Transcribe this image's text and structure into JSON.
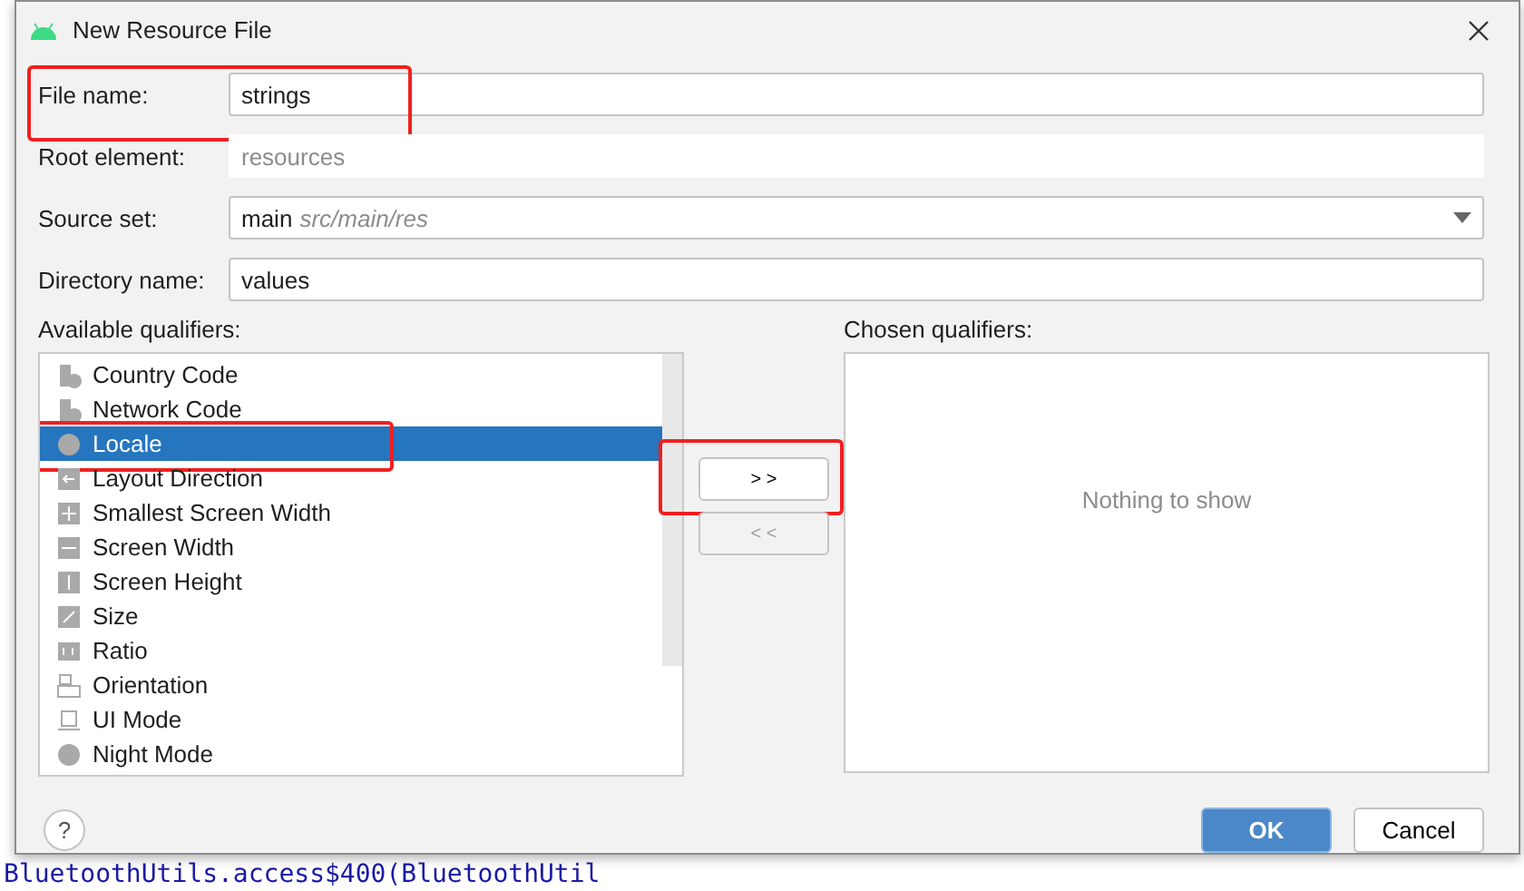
{
  "window": {
    "title": "New Resource File"
  },
  "fields": [
    {
      "kind": "text",
      "label": "File name:",
      "value": "strings",
      "disabled": false,
      "highlighted": true
    },
    {
      "kind": "text",
      "label": "Root element:",
      "placeholder": "resources",
      "disabled": true,
      "highlighted": false
    },
    {
      "kind": "select",
      "label": "Source set:",
      "value": "main",
      "detail": "src/main/res",
      "disabled": false,
      "highlighted": false
    },
    {
      "kind": "text",
      "label": "Directory name:",
      "value": "values",
      "disabled": false,
      "highlighted": false
    }
  ],
  "available": {
    "label": "Available qualifiers:",
    "items": [
      {
        "label": "Country Code",
        "selected": false,
        "highlighted": false
      },
      {
        "label": "Network Code",
        "selected": false,
        "highlighted": false
      },
      {
        "label": "Locale",
        "selected": true,
        "highlighted": true
      },
      {
        "label": "Layout Direction",
        "selected": false,
        "highlighted": false
      },
      {
        "label": "Smallest Screen Width",
        "selected": false,
        "highlighted": false
      },
      {
        "label": "Screen Width",
        "selected": false,
        "highlighted": false
      },
      {
        "label": "Screen Height",
        "selected": false,
        "highlighted": false
      },
      {
        "label": "Size",
        "selected": false,
        "highlighted": false
      },
      {
        "label": "Ratio",
        "selected": false,
        "highlighted": false
      },
      {
        "label": "Orientation",
        "selected": false,
        "highlighted": false
      },
      {
        "label": "UI Mode",
        "selected": false,
        "highlighted": false
      },
      {
        "label": "Night Mode",
        "selected": false,
        "highlighted": false
      }
    ]
  },
  "move_buttons": [
    {
      "label": "> >",
      "disabled": false,
      "highlighted": true
    },
    {
      "label": "< <",
      "disabled": true,
      "highlighted": false
    }
  ],
  "chosen": {
    "label": "Chosen qualifiers:",
    "empty_text": "Nothing to show"
  },
  "buttons": [
    {
      "label": "OK",
      "kind": "default"
    },
    {
      "label": "Cancel",
      "kind": "normal"
    }
  ],
  "help_button": "?",
  "background": {
    "code_line": "BluetoothUtils.access$400(BluetoothUtil"
  }
}
